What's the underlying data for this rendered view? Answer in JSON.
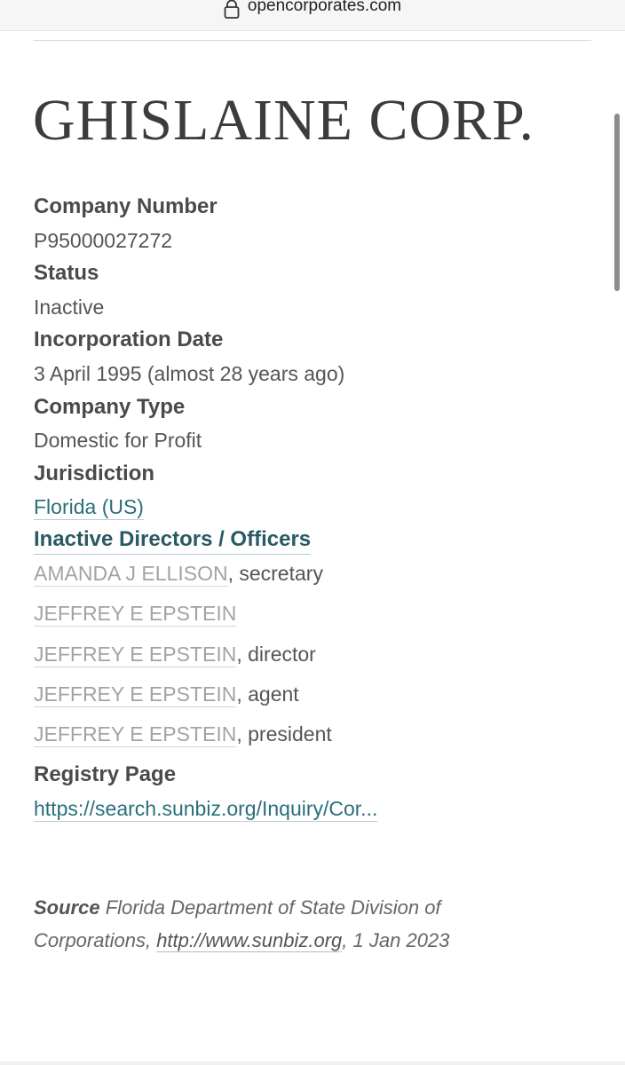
{
  "browser": {
    "url": "opencorporates.com"
  },
  "company": {
    "name": "GHISLAINE CORP."
  },
  "fields": {
    "company_number": {
      "label": "Company Number",
      "value": "P95000027272"
    },
    "status": {
      "label": "Status",
      "value": "Inactive"
    },
    "incorporation_date": {
      "label": "Incorporation Date",
      "value": "3 April 1995 (almost 28 years ago)"
    },
    "company_type": {
      "label": "Company Type",
      "value": "Domestic for Profit"
    },
    "jurisdiction": {
      "label": "Jurisdiction",
      "value": "Florida (US)"
    }
  },
  "officers": {
    "heading": "Inactive Directors / Officers",
    "items": [
      {
        "name": "AMANDA J ELLISON",
        "role": ", secretary"
      },
      {
        "name": "JEFFREY E EPSTEIN",
        "role": ""
      },
      {
        "name": "JEFFREY E EPSTEIN",
        "role": ", director"
      },
      {
        "name": "JEFFREY E EPSTEIN",
        "role": ", agent"
      },
      {
        "name": "JEFFREY E EPSTEIN",
        "role": ", president"
      }
    ]
  },
  "registry": {
    "label": "Registry Page",
    "link": "https://search.sunbiz.org/Inquiry/Cor..."
  },
  "source": {
    "label": "Source",
    "text_before": " Florida Department of State Division of Corporations, ",
    "link": "http://www.sunbiz.org",
    "text_after": ", 1 Jan 2023"
  },
  "colors": {
    "teal_link": "#2a6f7c",
    "teal_heading": "#2a5a63",
    "inactive_name": "#a3a3a3"
  }
}
